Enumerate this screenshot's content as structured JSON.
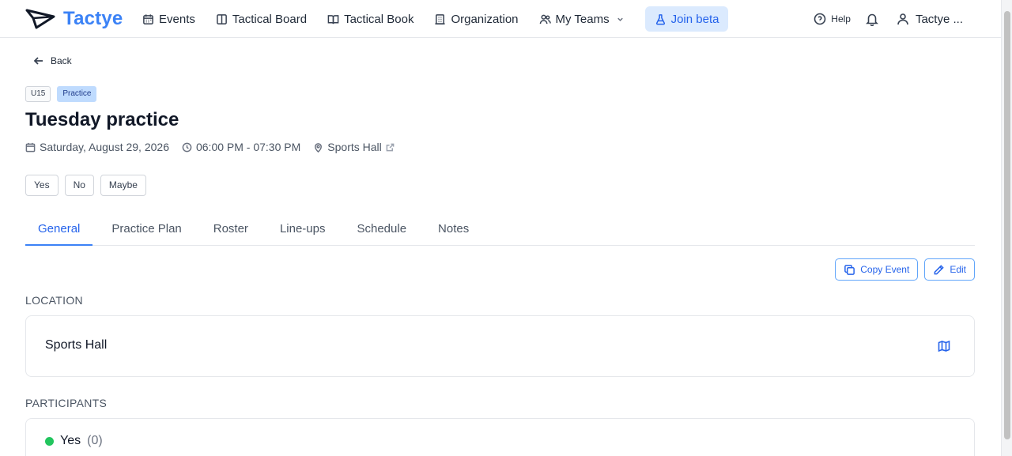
{
  "brand": {
    "name": "Tactye",
    "accent": "#3b82f6"
  },
  "nav": {
    "items": [
      {
        "label": "Events",
        "icon": "calendar-icon"
      },
      {
        "label": "Tactical Board",
        "icon": "board-icon"
      },
      {
        "label": "Tactical Book",
        "icon": "book-icon"
      },
      {
        "label": "Organization",
        "icon": "building-icon"
      },
      {
        "label": "My Teams",
        "icon": "users-icon"
      }
    ],
    "beta_label": "Join beta",
    "help_label": "Help",
    "user_label": "Tactye ..."
  },
  "page": {
    "back_label": "Back",
    "tags": [
      "U15",
      "Practice"
    ],
    "title": "Tuesday practice",
    "date": "Saturday, August 29, 2026",
    "time": "06:00 PM - 07:30 PM",
    "location": "Sports Hall"
  },
  "rsvp": [
    "Yes",
    "No",
    "Maybe"
  ],
  "tabs": [
    "General",
    "Practice Plan",
    "Roster",
    "Line-ups",
    "Schedule",
    "Notes"
  ],
  "active_tab": "General",
  "actions": {
    "copy_label": "Copy Event",
    "edit_label": "Edit"
  },
  "location_section": {
    "heading": "LOCATION",
    "name": "Sports Hall"
  },
  "participants_section": {
    "heading": "PARTICIPANTS",
    "rows": [
      {
        "label": "Yes",
        "count": "(0)",
        "color": "#22c55e"
      }
    ]
  }
}
